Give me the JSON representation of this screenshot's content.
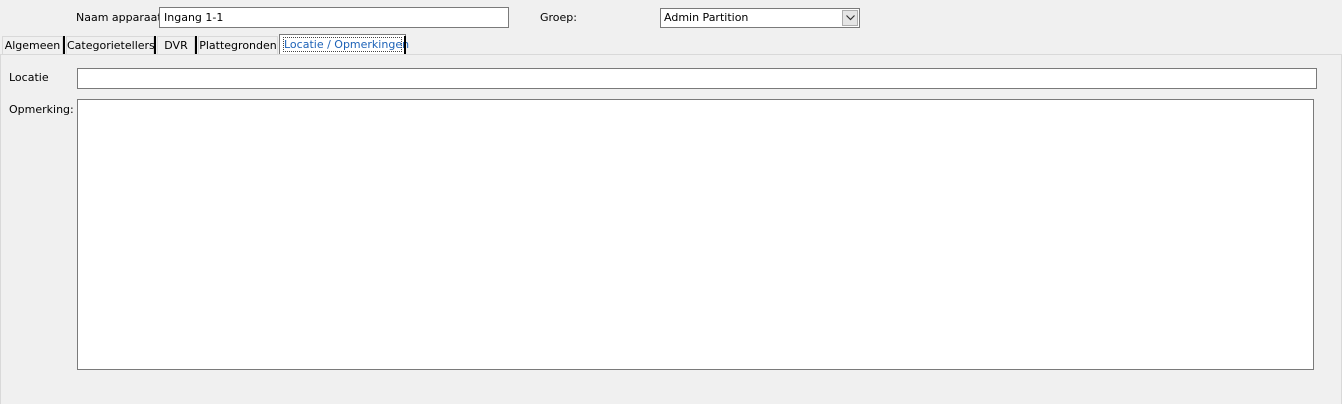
{
  "header": {
    "naam_label": "Naam apparaat",
    "naam_value": "Ingang 1-1",
    "groep_label": "Groep:",
    "groep_value": "Admin Partition"
  },
  "tabs": [
    {
      "label": "Algemeen",
      "active": false
    },
    {
      "label": "Categorietellers",
      "active": false
    },
    {
      "label": "DVR",
      "active": false
    },
    {
      "label": "Plattegronden",
      "active": false
    },
    {
      "label": "Locatie / Opmerkingen",
      "active": true
    }
  ],
  "form": {
    "locatie_label": "Locatie",
    "locatie_value": "",
    "opmerking_label": "Opmerking:",
    "opmerking_value": ""
  },
  "colors": {
    "active_tab_text": "#1d62b7",
    "window_bg": "#f0f0f0"
  }
}
